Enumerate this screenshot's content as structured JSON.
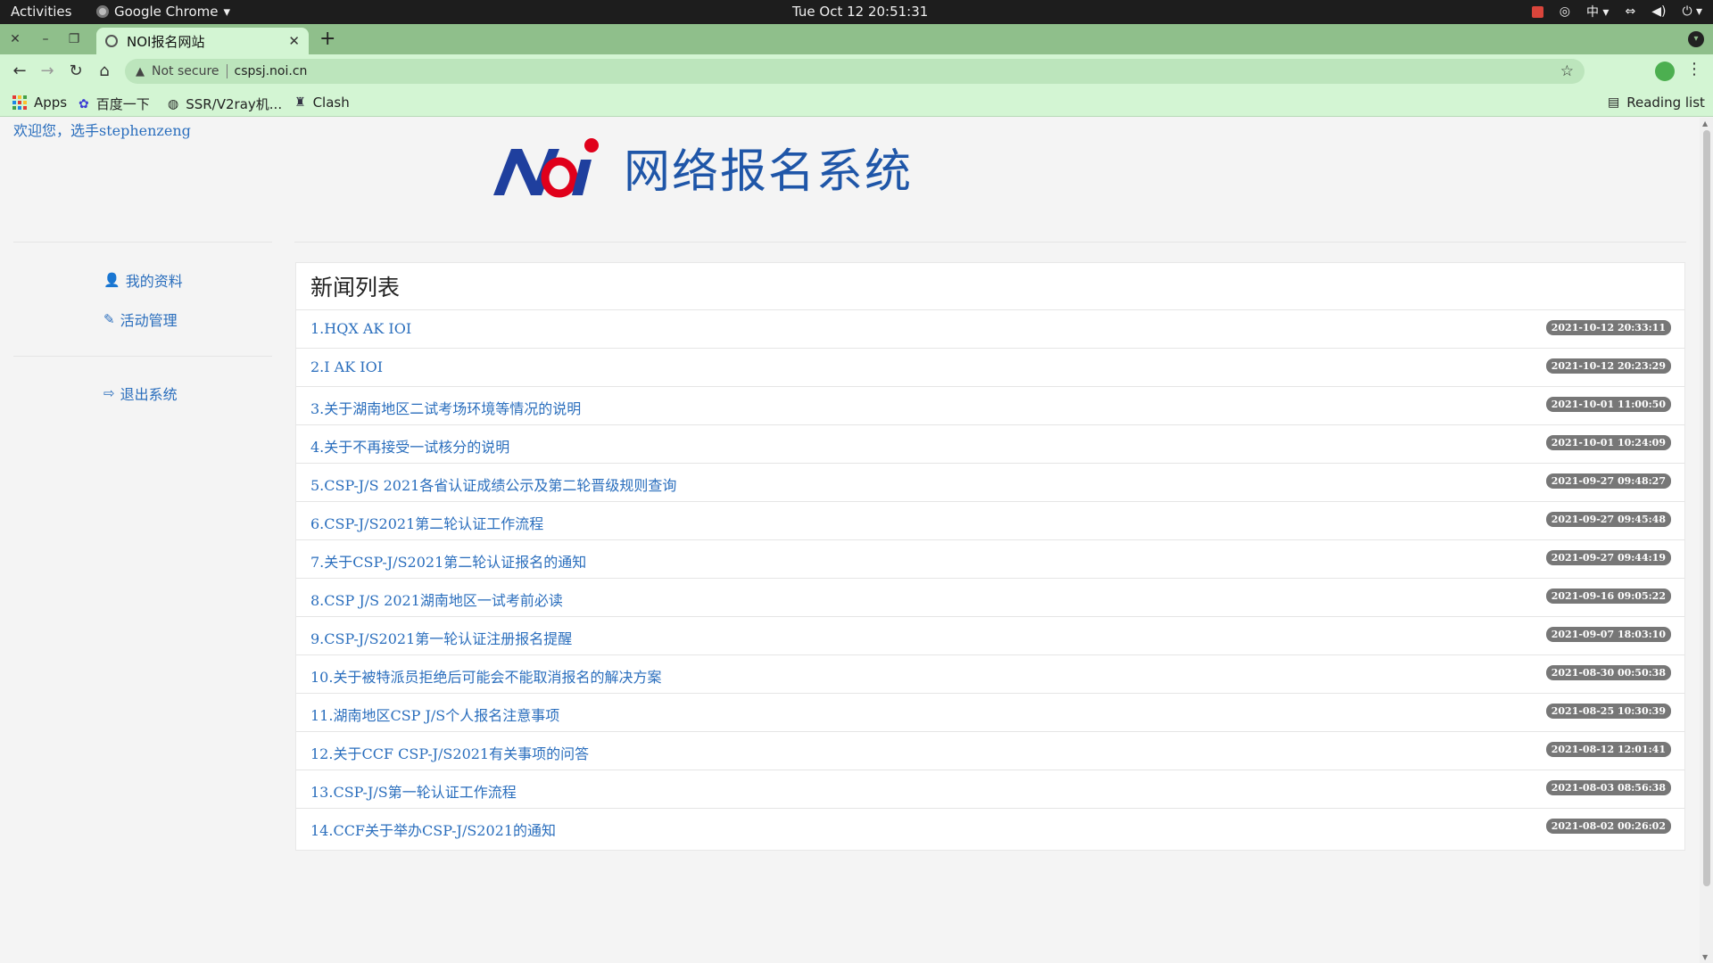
{
  "os_bar": {
    "activities": "Activities",
    "app_name": "Google Chrome",
    "clock": "Tue Oct 12  20:51:31",
    "input_method": "中"
  },
  "browser": {
    "tab_title": "NOI报名网站",
    "security_label": "Not secure",
    "url": "cspsj.noi.cn",
    "bookmarks": [
      {
        "label": "Apps",
        "icon": "apps-grid-icon"
      },
      {
        "label": "百度一下",
        "icon": "baidu-paw-icon"
      },
      {
        "label": "SSR/V2ray机...",
        "icon": "globe-icon"
      },
      {
        "label": "Clash",
        "icon": "cat-icon"
      }
    ],
    "reading_list": "Reading list"
  },
  "page": {
    "welcome": "欢迎您，选手stephenzeng",
    "site_title": "网络报名系统",
    "logo_text": "NOI",
    "sidebar": [
      {
        "label": "我的资料",
        "icon": "user-icon"
      },
      {
        "label": "活动管理",
        "icon": "edit-icon"
      },
      {
        "label": "退出系统",
        "icon": "logout-icon"
      }
    ],
    "news_title": "新闻列表",
    "news": [
      {
        "title": "1.HQX AK IOI",
        "date": "2021-10-12 20:33:11"
      },
      {
        "title": "2.I AK IOI",
        "date": "2021-10-12 20:23:29"
      },
      {
        "title": "3.关于湖南地区二试考场环境等情况的说明",
        "date": "2021-10-01 11:00:50"
      },
      {
        "title": "4.关于不再接受一试核分的说明",
        "date": "2021-10-01 10:24:09"
      },
      {
        "title": "5.CSP-J/S 2021各省认证成绩公示及第二轮晋级规则查询",
        "date": "2021-09-27 09:48:27"
      },
      {
        "title": "6.CSP-J/S2021第二轮认证工作流程",
        "date": "2021-09-27 09:45:48"
      },
      {
        "title": "7.关于CSP-J/S2021第二轮认证报名的通知",
        "date": "2021-09-27 09:44:19"
      },
      {
        "title": "8.CSP J/S 2021湖南地区一试考前必读",
        "date": "2021-09-16 09:05:22"
      },
      {
        "title": "9.CSP-J/S2021第一轮认证注册报名提醒",
        "date": "2021-09-07 18:03:10"
      },
      {
        "title": "10.关于被特派员拒绝后可能会不能取消报名的解决方案",
        "date": "2021-08-30 00:50:38"
      },
      {
        "title": "11.湖南地区CSP J/S个人报名注意事项",
        "date": "2021-08-25 10:30:39"
      },
      {
        "title": "12.关于CCF CSP-J/S2021有关事项的问答",
        "date": "2021-08-12 12:01:41"
      },
      {
        "title": "13.CSP-J/S第一轮认证工作流程",
        "date": "2021-08-03 08:56:38"
      },
      {
        "title": "14.CCF关于举办CSP-J/S2021的通知",
        "date": "2021-08-02 00:26:02"
      }
    ]
  },
  "colors": {
    "link": "#2a6ebd",
    "title_blue": "#1f56a8",
    "logo_red": "#e0001b",
    "tab_strip": "#8fbf8b",
    "toolbar": "#d3f5d3",
    "badge": "#777777"
  }
}
